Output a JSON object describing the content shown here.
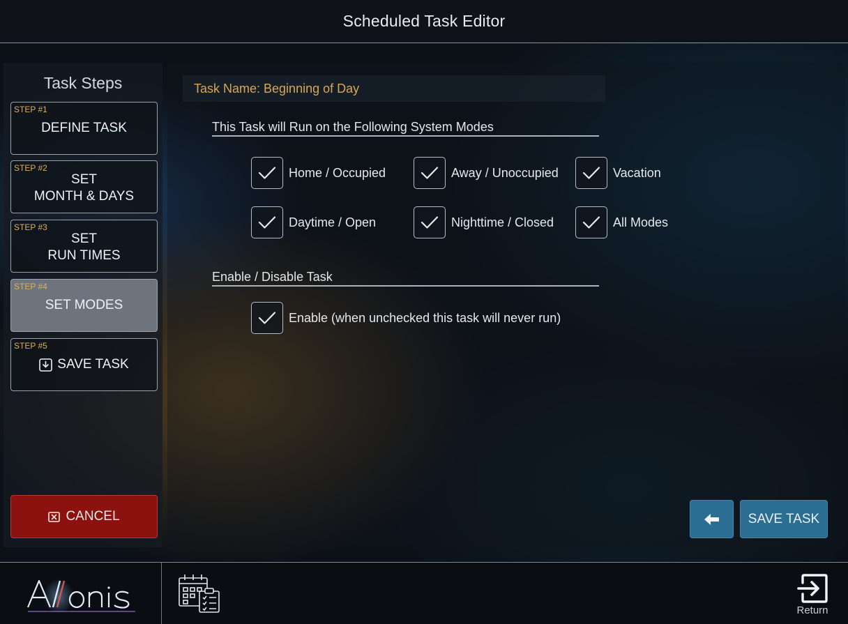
{
  "header": {
    "title": "Scheduled Task Editor"
  },
  "sidebar": {
    "title": "Task Steps",
    "steps": [
      {
        "num": "STEP #1",
        "label": "DEFINE TASK"
      },
      {
        "num": "STEP #2",
        "line1": "SET",
        "line2": "MONTH & DAYS"
      },
      {
        "num": "STEP #3",
        "line1": "SET",
        "line2": "RUN TIMES"
      },
      {
        "num": "STEP #4",
        "label": "SET MODES"
      },
      {
        "num": "STEP #5",
        "label": "SAVE TASK"
      }
    ],
    "active_step": 4,
    "cancel_label": "CANCEL"
  },
  "main": {
    "task_name": "Task Name: Beginning of Day",
    "modes_heading": "This Task will Run on the Following System Modes",
    "modes": [
      {
        "label": "Home / Occupied",
        "checked": true
      },
      {
        "label": "Away / Unoccupied",
        "checked": true
      },
      {
        "label": "Vacation",
        "checked": true
      },
      {
        "label": "Daytime / Open",
        "checked": true
      },
      {
        "label": "Nighttime / Closed",
        "checked": true
      },
      {
        "label": "All Modes",
        "checked": true
      }
    ],
    "enable_heading": "Enable / Disable Task",
    "enable": {
      "label": "Enable (when unchecked this task will never run)",
      "checked": true
    },
    "save_label": "SAVE TASK",
    "back_icon": "arrow-left-icon"
  },
  "footer": {
    "logo_text": "Allonis",
    "calendar_icon": "calendar-schedule-icon",
    "return_label": "Return"
  },
  "colors": {
    "accent_blue": "#2b6e92",
    "cancel_red": "#8c120f",
    "step_number": "#e0ae58",
    "task_name": "#d8a655",
    "active_step": "#6d747d"
  }
}
